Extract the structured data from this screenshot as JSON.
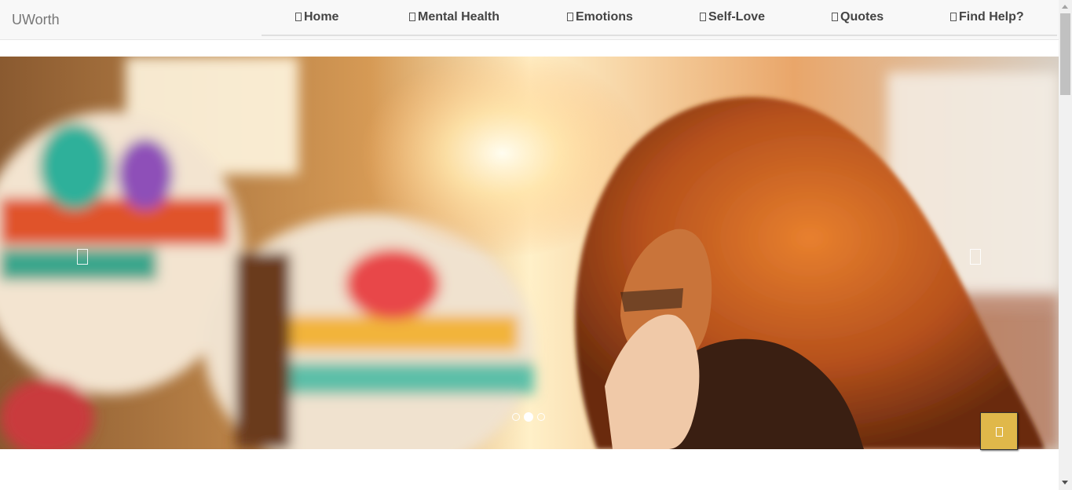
{
  "brand": "UWorth",
  "nav": {
    "items": [
      {
        "label": "Home",
        "icon": "home-icon"
      },
      {
        "label": "Mental Health",
        "icon": "brain-icon"
      },
      {
        "label": "Emotions",
        "icon": "emotions-icon"
      },
      {
        "label": "Self-Love",
        "icon": "heart-icon"
      },
      {
        "label": "Quotes",
        "icon": "quote-icon"
      },
      {
        "label": "Find Help?",
        "icon": "help-icon"
      }
    ]
  },
  "carousel": {
    "slide_count": 3,
    "active_index": 1,
    "prev_icon": "chevron-left-icon",
    "next_icon": "chevron-right-icon"
  },
  "back_to_top": {
    "icon": "chevron-up-icon",
    "color": "#e0b84a"
  }
}
